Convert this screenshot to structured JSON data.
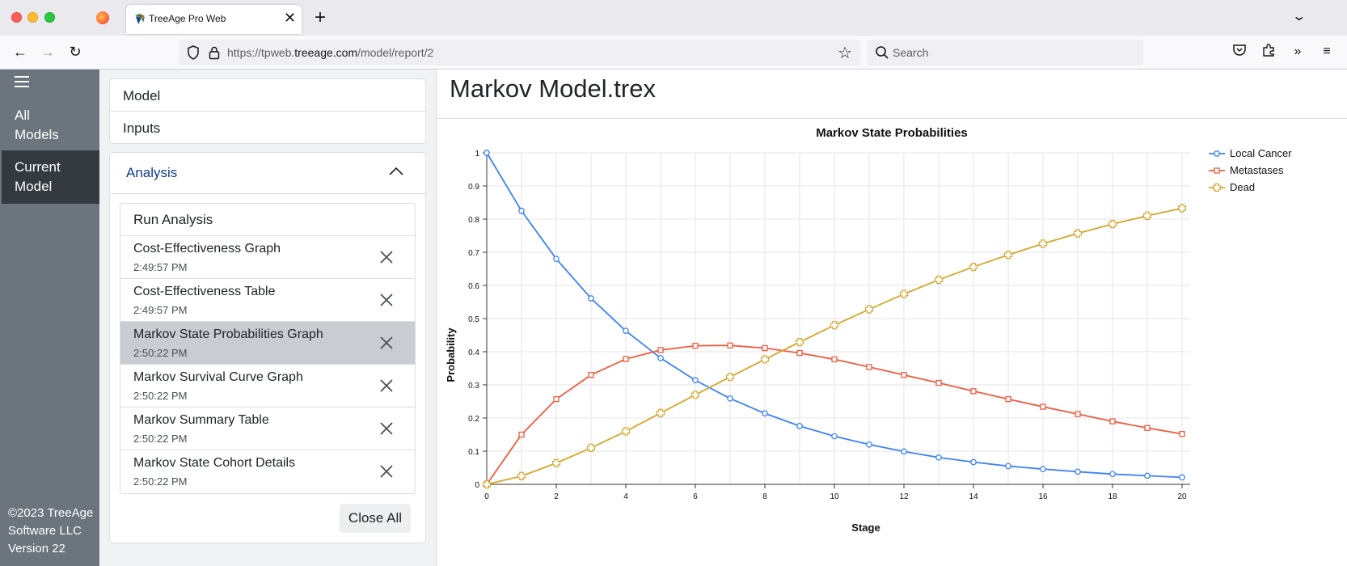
{
  "browser": {
    "tab_title": "TreeAge Pro Web",
    "url_prefix": "https://tpweb.",
    "url_domain": "treeage.com",
    "url_path": "/model/report/2",
    "search_placeholder": "Search"
  },
  "nav": {
    "all_models_line1": "All",
    "all_models_line2": "Models",
    "current_model_line1": "Current",
    "current_model_line2": "Model",
    "copyright_line1": "©2023 TreeAge",
    "copyright_line2": "Software LLC",
    "version": "Version 22"
  },
  "sidebar": {
    "model_label": "Model",
    "inputs_label": "Inputs",
    "analysis_label": "Analysis",
    "run_analysis_label": "Run Analysis",
    "items": [
      {
        "title": "Cost-Effectiveness Graph",
        "time": "2:49:57 PM",
        "selected": false
      },
      {
        "title": "Cost-Effectiveness Table",
        "time": "2:49:57 PM",
        "selected": false
      },
      {
        "title": "Markov State Probabilities Graph",
        "time": "2:50:22 PM",
        "selected": true
      },
      {
        "title": "Markov Survival Curve Graph",
        "time": "2:50:22 PM",
        "selected": false
      },
      {
        "title": "Markov Summary Table",
        "time": "2:50:22 PM",
        "selected": false
      },
      {
        "title": "Markov State Cohort Details",
        "time": "2:50:22 PM",
        "selected": false
      }
    ],
    "close_all_label": "Close All"
  },
  "main": {
    "title": "Markov Model.trex"
  },
  "colors": {
    "nav_bg": "#6c757d",
    "nav_active": "#343a40",
    "local_cancer": "#3b82f6",
    "metastases": "#ef5b3e",
    "dead": "#d4a72c"
  },
  "chart_data": {
    "type": "line",
    "title": "Markov State Probabilities",
    "xlabel": "Stage",
    "ylabel": "Probability",
    "xlim": [
      0,
      20
    ],
    "ylim": [
      0,
      1
    ],
    "x_ticks": [
      0,
      2,
      4,
      6,
      8,
      10,
      12,
      14,
      16,
      18,
      20
    ],
    "y_ticks": [
      0,
      0.1,
      0.2,
      0.3,
      0.4,
      0.5,
      0.6,
      0.7,
      0.8,
      0.9,
      1
    ],
    "grid": true,
    "legend_position": "top-right",
    "x": [
      0,
      1,
      2,
      3,
      4,
      5,
      6,
      7,
      8,
      9,
      10,
      11,
      12,
      13,
      14,
      15,
      16,
      17,
      18,
      19,
      20
    ],
    "series": [
      {
        "name": "Local Cancer",
        "marker": "circle",
        "color": "#3b82f6",
        "values": [
          1.0,
          0.825,
          0.68,
          0.561,
          0.463,
          0.381,
          0.314,
          0.259,
          0.214,
          0.176,
          0.145,
          0.12,
          0.099,
          0.081,
          0.067,
          0.055,
          0.046,
          0.038,
          0.031,
          0.026,
          0.021
        ]
      },
      {
        "name": "Metastases",
        "marker": "square",
        "color": "#ef5b3e",
        "values": [
          0.0,
          0.15,
          0.257,
          0.33,
          0.378,
          0.405,
          0.418,
          0.419,
          0.411,
          0.396,
          0.377,
          0.354,
          0.33,
          0.306,
          0.281,
          0.257,
          0.234,
          0.212,
          0.19,
          0.17,
          0.152
        ]
      },
      {
        "name": "Dead",
        "marker": "plus",
        "color": "#d4a72c",
        "values": [
          0.0,
          0.025,
          0.064,
          0.11,
          0.16,
          0.215,
          0.27,
          0.324,
          0.377,
          0.429,
          0.48,
          0.528,
          0.574,
          0.617,
          0.656,
          0.692,
          0.726,
          0.757,
          0.785,
          0.81,
          0.833
        ]
      }
    ]
  }
}
